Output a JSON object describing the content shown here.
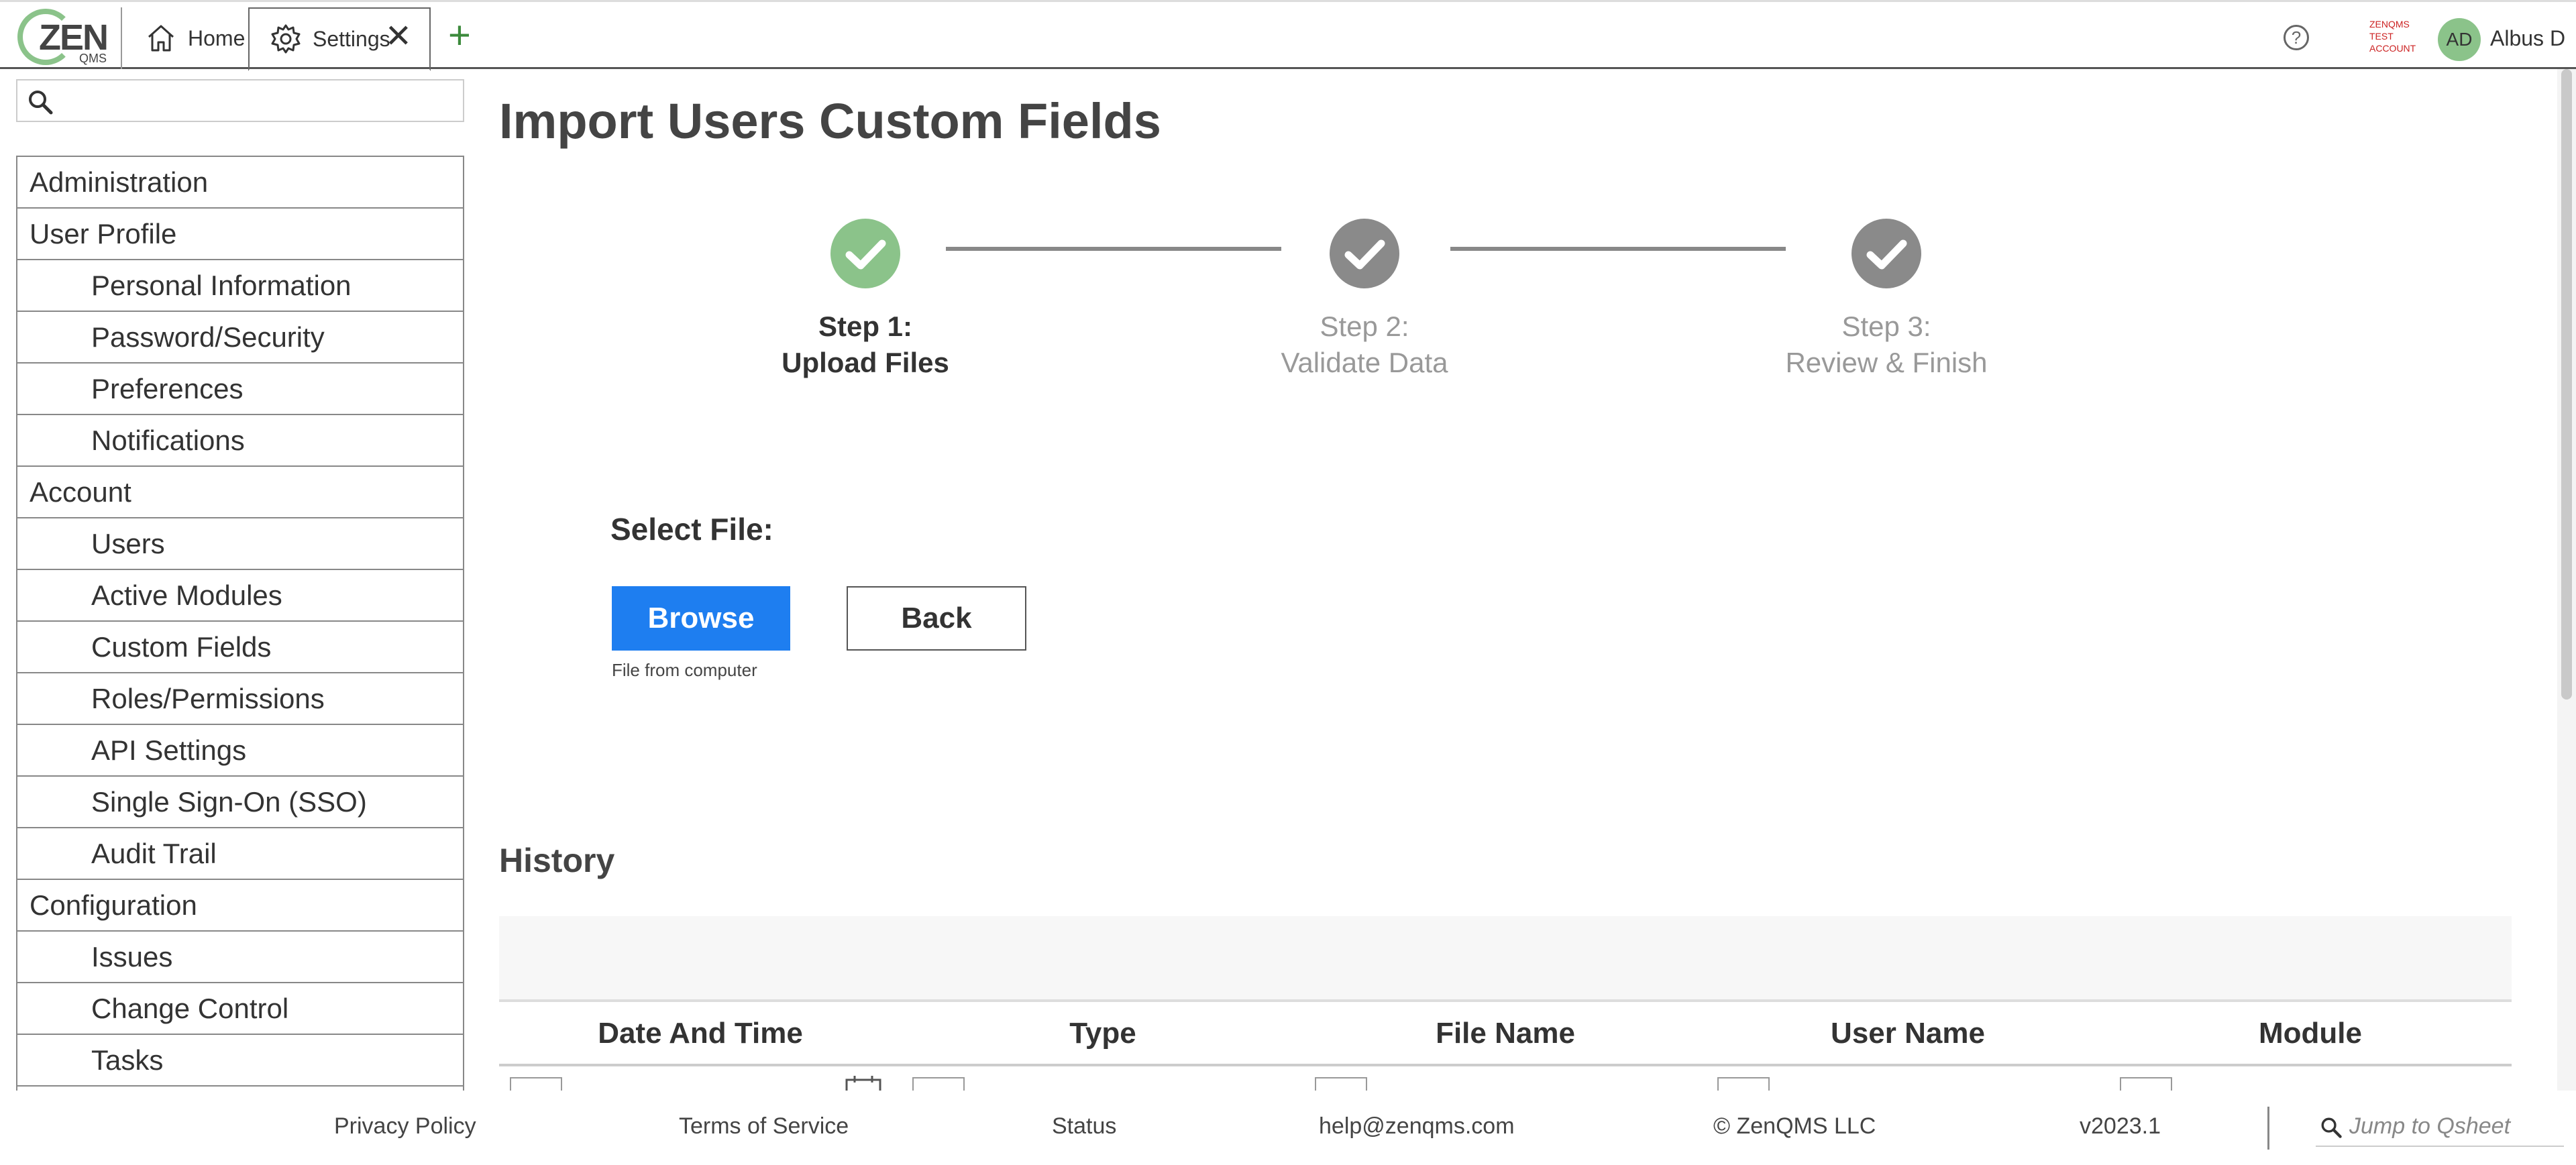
{
  "header": {
    "logo_text": "ZEN",
    "logo_sub": "QMS",
    "tabs": [
      {
        "label": "Home",
        "icon": "home-icon"
      },
      {
        "label": "Settings",
        "icon": "gear-icon"
      }
    ],
    "help_label": "?",
    "test_account": "ZENQMS TEST ACCOUNT",
    "avatar_initials": "AD",
    "user_name": "Albus D"
  },
  "sidebar": {
    "search_placeholder": "",
    "items": [
      {
        "label": "Administration",
        "level": 0
      },
      {
        "label": "User Profile",
        "level": 0
      },
      {
        "label": "Personal Information",
        "level": 1
      },
      {
        "label": "Password/Security",
        "level": 1
      },
      {
        "label": "Preferences",
        "level": 1
      },
      {
        "label": "Notifications",
        "level": 1
      },
      {
        "label": "Account",
        "level": 0
      },
      {
        "label": "Users",
        "level": 1
      },
      {
        "label": "Active Modules",
        "level": 1
      },
      {
        "label": "Custom Fields",
        "level": 1
      },
      {
        "label": "Roles/Permissions",
        "level": 1
      },
      {
        "label": "API Settings",
        "level": 1
      },
      {
        "label": "Single Sign-On (SSO)",
        "level": 1
      },
      {
        "label": "Audit Trail",
        "level": 1
      },
      {
        "label": "Configuration",
        "level": 0
      },
      {
        "label": "Issues",
        "level": 1
      },
      {
        "label": "Change Control",
        "level": 1
      },
      {
        "label": "Tasks",
        "level": 1
      }
    ]
  },
  "main": {
    "title": "Import Users Custom Fields",
    "steps": [
      {
        "line1": "Step 1:",
        "line2": "Upload Files",
        "state": "active"
      },
      {
        "line1": "Step 2:",
        "line2": "Validate Data",
        "state": "pending"
      },
      {
        "line1": "Step 3:",
        "line2": "Review & Finish",
        "state": "pending"
      }
    ],
    "select_file_label": "Select File:",
    "browse_label": "Browse",
    "back_label": "Back",
    "browse_hint": "File from computer",
    "history_title": "History",
    "columns": [
      "Date And Time",
      "Type",
      "File Name",
      "User Name",
      "Module"
    ]
  },
  "footer": {
    "links": [
      "Privacy Policy",
      "Terms of Service",
      "Status",
      "help@zenqms.com",
      "© ZenQMS LLC",
      "v2023.1"
    ],
    "jump_placeholder": "Jump to Qsheet"
  },
  "colors": {
    "accent_blue": "#1e7ef0",
    "success_green": "#8bc38a",
    "step_gray": "#8a8a8a",
    "plus_green": "#3c8a3c",
    "test_account_red": "#cc2222"
  }
}
